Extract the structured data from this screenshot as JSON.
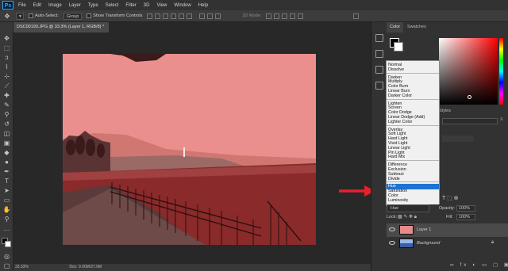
{
  "app": {
    "logo": "Ps"
  },
  "menu": [
    "File",
    "Edit",
    "Image",
    "Layer",
    "Type",
    "Select",
    "Filter",
    "3D",
    "View",
    "Window",
    "Help"
  ],
  "options": {
    "auto_select_label": "Auto-Select:",
    "auto_select_value": "Group",
    "transform_controls_label": "Show Transform Controls",
    "mode_3d": "3D Mode:"
  },
  "document": {
    "tab_title": "DSC00190.JPG @ 33.3% (Layer 1, RGB/8) *"
  },
  "status": {
    "zoom": "33.33%",
    "doc_size": "Doc: 9.00M/27.0M"
  },
  "panel": {
    "tab_color": "Color",
    "tab_swatches": "Swatches",
    "tab_styles": "Styles",
    "blend_current": "Hue",
    "opacity_label": "Opacity:",
    "opacity_value": "100%",
    "lock_label": "Lock:",
    "fill_label": "Fill:",
    "fill_value": "100%"
  },
  "blend_modes": [
    {
      "label": "Normal",
      "group": 0
    },
    {
      "label": "Dissolve",
      "group": 0
    },
    {
      "label": "Darken",
      "group": 1
    },
    {
      "label": "Multiply",
      "group": 1
    },
    {
      "label": "Color Burn",
      "group": 1
    },
    {
      "label": "Linear Burn",
      "group": 1
    },
    {
      "label": "Darker Color",
      "group": 1
    },
    {
      "label": "Lighten",
      "group": 2
    },
    {
      "label": "Screen",
      "group": 2
    },
    {
      "label": "Color Dodge",
      "group": 2
    },
    {
      "label": "Linear Dodge (Add)",
      "group": 2
    },
    {
      "label": "Lighter Color",
      "group": 2
    },
    {
      "label": "Overlay",
      "group": 3
    },
    {
      "label": "Soft Light",
      "group": 3
    },
    {
      "label": "Hard Light",
      "group": 3
    },
    {
      "label": "Vivid Light",
      "group": 3
    },
    {
      "label": "Linear Light",
      "group": 3
    },
    {
      "label": "Pin Light",
      "group": 3
    },
    {
      "label": "Hard Mix",
      "group": 3
    },
    {
      "label": "Difference",
      "group": 4
    },
    {
      "label": "Exclusion",
      "group": 4
    },
    {
      "label": "Subtract",
      "group": 4
    },
    {
      "label": "Divide",
      "group": 4
    },
    {
      "label": "Hue",
      "group": 5,
      "selected": true
    },
    {
      "label": "Saturation",
      "group": 5
    },
    {
      "label": "Color",
      "group": 5
    },
    {
      "label": "Luminosity",
      "group": 5
    }
  ],
  "layers": [
    {
      "name": "Layer 1",
      "selected": true
    },
    {
      "name": "Background",
      "selected": false
    }
  ],
  "colors": {
    "accent": "#1e73d2",
    "arrow": "#e8202a",
    "photo_tint": "#e88a8a",
    "water": "#8a2a2a"
  }
}
